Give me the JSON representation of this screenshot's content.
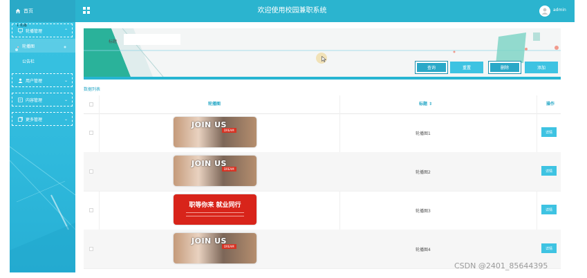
{
  "topbar": {
    "home_label": "首页",
    "title": "欢迎使用校园兼职系统",
    "username": "admin"
  },
  "sidebar": {
    "tiny_label": "1  轮播",
    "groups": [
      {
        "label": "轮播管理",
        "expanded": true,
        "sub": [
          "轮播图",
          "公告栏"
        ]
      },
      {
        "label": "用户管理"
      },
      {
        "label": "内容管理"
      },
      {
        "label": "更多管理"
      }
    ]
  },
  "banner": {
    "search_label": "标题",
    "search_placeholder": "",
    "buttons": [
      "查询",
      "重置",
      "删除",
      "添加"
    ]
  },
  "section_title": "数据列表",
  "table": {
    "headers": {
      "image": "轮播图",
      "title": "标题 ⇕",
      "actions": "操作"
    },
    "rows": [
      {
        "img_text": "JOIN US",
        "img_badge": "DREAM",
        "title": "轮播图1",
        "action": "详情"
      },
      {
        "img_text": "JOIN US",
        "img_badge": "DREAM",
        "title": "轮播图2",
        "action": "详情"
      },
      {
        "img_text": "职等你来  就业同行",
        "img_badge": "",
        "title": "轮播图3",
        "action": "详情"
      },
      {
        "img_text": "JOIN US",
        "img_badge": "DREAM",
        "title": "轮播图4",
        "action": "详情"
      }
    ]
  },
  "watermark": "CSDN @2401_85644395",
  "colors": {
    "accent": "#2bb4cf",
    "button": "#3ec3e2"
  }
}
